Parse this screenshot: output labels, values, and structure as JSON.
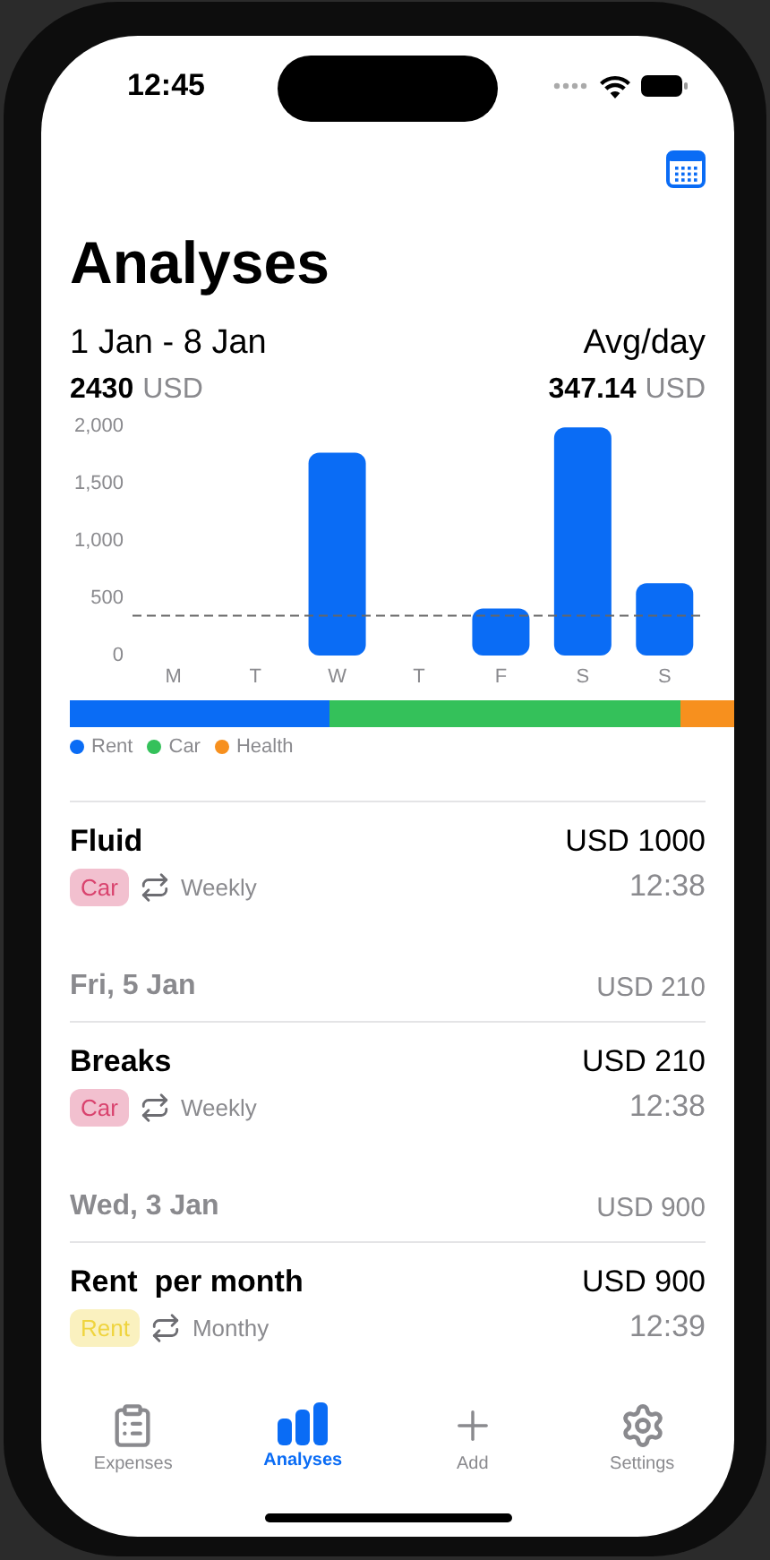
{
  "status_bar": {
    "time": "12:45"
  },
  "title": "Analyses",
  "summary": {
    "range": "1 Jan - 8 Jan",
    "avg_label": "Avg/day",
    "total": "2430",
    "total_currency": "USD",
    "avg": "347.14",
    "avg_currency": "USD"
  },
  "chart_data": {
    "type": "bar",
    "categories": [
      "M",
      "T",
      "W",
      "T",
      "F",
      "S",
      "S"
    ],
    "series": [
      {
        "color": "#0a6cf5",
        "values": [
          0,
          0,
          1770,
          0,
          410,
          1990,
          630
        ]
      }
    ],
    "ylim": [
      0,
      2000
    ],
    "yticks": [
      {
        "value": 0,
        "label": "0"
      },
      {
        "value": 500,
        "label": "500"
      },
      {
        "value": 1000,
        "label": "1,000"
      },
      {
        "value": 1500,
        "label": "1,500"
      },
      {
        "value": 2000,
        "label": "2,000"
      }
    ],
    "ref_lines": [
      {
        "axis": "y",
        "value": 347.14
      }
    ]
  },
  "category_bar": [
    {
      "name": "Rent",
      "color": "#0a6cf5"
    },
    {
      "name": "Car",
      "color": "#34c15a"
    },
    {
      "name": "Health",
      "color": "#f7901e"
    }
  ],
  "entries": [
    {
      "kind": "expense",
      "title": "Fluid",
      "amount": "USD 1000",
      "tag": "Car",
      "color": "#d9436e",
      "repeat": "Weekly",
      "time": "12:38"
    },
    {
      "kind": "header",
      "date": "Fri, 5 Jan",
      "total": "USD 210"
    },
    {
      "kind": "expense",
      "title": "Breaks",
      "amount": "USD 210",
      "tag": "Car",
      "color": "#d9436e",
      "repeat": "Weekly",
      "time": "12:38"
    },
    {
      "kind": "header",
      "date": "Wed, 3 Jan",
      "total": "USD 900"
    },
    {
      "kind": "expense",
      "title": "Rent  per month",
      "amount": "USD 900",
      "tag": "Rent",
      "color": "#efd43e",
      "repeat": "Monthy",
      "time": "12:39"
    }
  ],
  "tabs": [
    {
      "kind": "list",
      "label": "Expenses",
      "selected": false
    },
    {
      "kind": "chart",
      "label": "Analyses",
      "selected": true
    },
    {
      "kind": "add",
      "label": "Add",
      "selected": false
    },
    {
      "kind": "settings",
      "label": "Settings",
      "selected": false
    }
  ]
}
